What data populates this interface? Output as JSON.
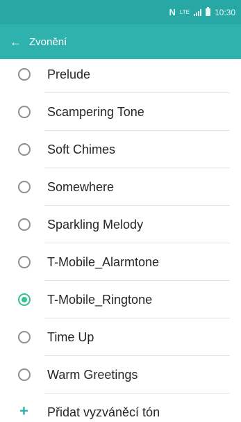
{
  "status_bar": {
    "n_icon": "N",
    "network": "LTE",
    "time": "10:30",
    "icons": [
      "nfc-icon",
      "lte-icon",
      "signal-icon",
      "battery-icon"
    ]
  },
  "app_bar": {
    "back_icon": "arrow-left-icon",
    "title": "Zvonění"
  },
  "ringtones": [
    {
      "label": "Prelude",
      "selected": false
    },
    {
      "label": "Scampering Tone",
      "selected": false
    },
    {
      "label": "Soft Chimes",
      "selected": false
    },
    {
      "label": "Somewhere",
      "selected": false
    },
    {
      "label": "Sparkling Melody",
      "selected": false
    },
    {
      "label": "T-Mobile_Alarmtone",
      "selected": false
    },
    {
      "label": "T-Mobile_Ringtone",
      "selected": true
    },
    {
      "label": "Time Up",
      "selected": false
    },
    {
      "label": "Warm Greetings",
      "selected": false
    }
  ],
  "add_ringtone": {
    "icon": "plus-icon",
    "label": "Přidat vyzváněcí tón"
  },
  "colors": {
    "status_bar": "#27a8a4",
    "app_bar": "#2fb2ad",
    "radio_selected": "#34c28f",
    "radio_unselected": "#8f8f8f",
    "text": "#262626"
  }
}
